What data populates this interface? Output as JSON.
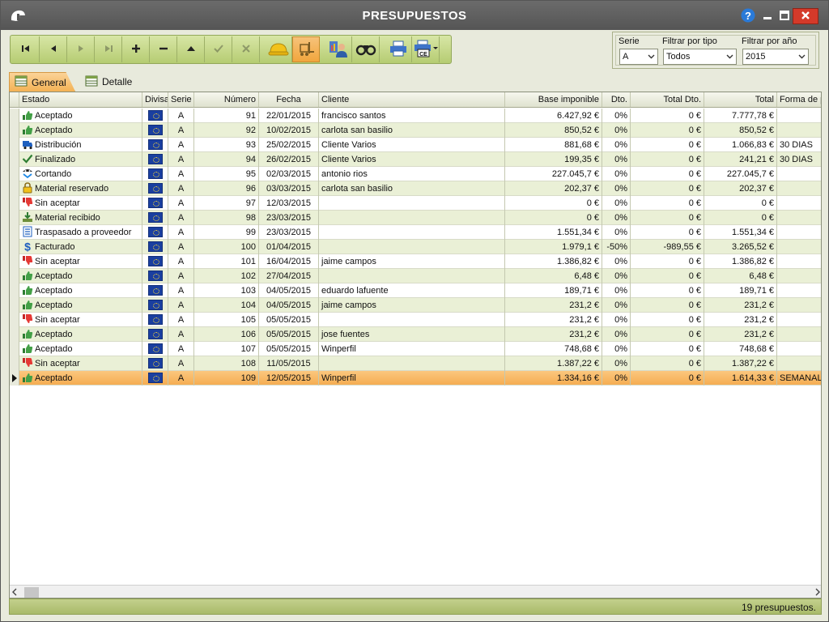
{
  "window": {
    "title": "PRESUPUESTOS",
    "help_icon": "question-mark-icon",
    "minimize_icon": "minimize-icon",
    "maximize_icon": "maximize-icon",
    "close_icon": "close-icon"
  },
  "toolbar": {
    "buttons": [
      {
        "icon": "first-record-icon",
        "enabled": true
      },
      {
        "icon": "previous-record-icon",
        "enabled": true
      },
      {
        "icon": "next-record-icon",
        "enabled": false
      },
      {
        "icon": "last-record-icon",
        "enabled": false
      },
      {
        "icon": "add-icon",
        "enabled": true
      },
      {
        "icon": "remove-icon",
        "enabled": true
      },
      {
        "icon": "move-up-icon",
        "enabled": true
      },
      {
        "icon": "confirm-check-icon",
        "enabled": false
      },
      {
        "icon": "cancel-x-icon",
        "enabled": false
      },
      {
        "icon": "hard-hat-icon",
        "enabled": true
      },
      {
        "icon": "forklift-icon",
        "enabled": true,
        "active": true
      },
      {
        "icon": "assign-user-icon",
        "enabled": true
      },
      {
        "icon": "binoculars-search-icon",
        "enabled": true
      },
      {
        "icon": "printer-icon",
        "enabled": true
      },
      {
        "icon": "printer-ce-icon",
        "enabled": true
      }
    ]
  },
  "filters": {
    "serie_label": "Serie",
    "serie_value": "A",
    "tipo_label": "Filtrar por tipo",
    "tipo_value": "Todos",
    "anio_label": "Filtrar por año",
    "anio_value": "2015"
  },
  "tabs": {
    "general": "General",
    "detalle": "Detalle"
  },
  "grid": {
    "headers": {
      "estado": "Estado",
      "divisa": "Divisa",
      "serie": "Serie",
      "numero": "Número",
      "fecha": "Fecha",
      "cliente": "Cliente",
      "base": "Base imponible",
      "dto": "Dto.",
      "total_dto": "Total Dto.",
      "total": "Total",
      "forma": "Forma de p"
    },
    "rows": [
      {
        "estado": "Aceptado",
        "icon": "thumbs-up-icon",
        "serie": "A",
        "numero": "91",
        "fecha": "22/01/2015",
        "cliente": "francisco santos",
        "base": "6.427,92 €",
        "dto": "0%",
        "total_dto": "0 €",
        "total": "7.777,78 €",
        "forma": ""
      },
      {
        "estado": "Aceptado",
        "icon": "thumbs-up-icon",
        "serie": "A",
        "numero": "92",
        "fecha": "10/02/2015",
        "cliente": "carlota san basilio",
        "base": "850,52 €",
        "dto": "0%",
        "total_dto": "0 €",
        "total": "850,52 €",
        "forma": ""
      },
      {
        "estado": "Distribución",
        "icon": "truck-icon",
        "serie": "A",
        "numero": "93",
        "fecha": "25/02/2015",
        "cliente": "Cliente Varios",
        "base": "881,68 €",
        "dto": "0%",
        "total_dto": "0 €",
        "total": "1.066,83 €",
        "forma": "30 DIAS"
      },
      {
        "estado": "Finalizado",
        "icon": "check-icon",
        "serie": "A",
        "numero": "94",
        "fecha": "26/02/2015",
        "cliente": "Cliente Varios",
        "base": "199,35 €",
        "dto": "0%",
        "total_dto": "0 €",
        "total": "241,21 €",
        "forma": "30 DIAS"
      },
      {
        "estado": "Cortando",
        "icon": "cutting-icon",
        "serie": "A",
        "numero": "95",
        "fecha": "02/03/2015",
        "cliente": "antonio rios",
        "base": "227.045,7 €",
        "dto": "0%",
        "total_dto": "0 €",
        "total": "227.045,7 €",
        "forma": ""
      },
      {
        "estado": "Material reservado",
        "icon": "lock-icon",
        "serie": "A",
        "numero": "96",
        "fecha": "03/03/2015",
        "cliente": "carlota san basilio",
        "base": "202,37 €",
        "dto": "0%",
        "total_dto": "0 €",
        "total": "202,37 €",
        "forma": ""
      },
      {
        "estado": "Sin aceptar",
        "icon": "thumbs-down-icon",
        "serie": "A",
        "numero": "97",
        "fecha": "12/03/2015",
        "cliente": "",
        "base": "0 €",
        "dto": "0%",
        "total_dto": "0 €",
        "total": "0 €",
        "forma": ""
      },
      {
        "estado": "Material recibido",
        "icon": "download-tray-icon",
        "serie": "A",
        "numero": "98",
        "fecha": "23/03/2015",
        "cliente": "",
        "base": "0 €",
        "dto": "0%",
        "total_dto": "0 €",
        "total": "0 €",
        "forma": ""
      },
      {
        "estado": "Traspasado a proveedor",
        "icon": "document-list-icon",
        "serie": "A",
        "numero": "99",
        "fecha": "23/03/2015",
        "cliente": "",
        "base": "1.551,34 €",
        "dto": "0%",
        "total_dto": "0 €",
        "total": "1.551,34 €",
        "forma": ""
      },
      {
        "estado": "Facturado",
        "icon": "dollar-icon",
        "serie": "A",
        "numero": "100",
        "fecha": "01/04/2015",
        "cliente": "",
        "base": "1.979,1 €",
        "dto": "-50%",
        "total_dto": "-989,55 €",
        "total": "3.265,52 €",
        "forma": ""
      },
      {
        "estado": "Sin aceptar",
        "icon": "thumbs-down-icon",
        "serie": "A",
        "numero": "101",
        "fecha": "16/04/2015",
        "cliente": "jaime campos",
        "base": "1.386,82 €",
        "dto": "0%",
        "total_dto": "0 €",
        "total": "1.386,82 €",
        "forma": ""
      },
      {
        "estado": "Aceptado",
        "icon": "thumbs-up-icon",
        "serie": "A",
        "numero": "102",
        "fecha": "27/04/2015",
        "cliente": "",
        "base": "6,48 €",
        "dto": "0%",
        "total_dto": "0 €",
        "total": "6,48 €",
        "forma": ""
      },
      {
        "estado": "Aceptado",
        "icon": "thumbs-up-icon",
        "serie": "A",
        "numero": "103",
        "fecha": "04/05/2015",
        "cliente": "eduardo lafuente",
        "base": "189,71 €",
        "dto": "0%",
        "total_dto": "0 €",
        "total": "189,71 €",
        "forma": ""
      },
      {
        "estado": "Aceptado",
        "icon": "thumbs-up-icon",
        "serie": "A",
        "numero": "104",
        "fecha": "04/05/2015",
        "cliente": "jaime campos",
        "base": "231,2 €",
        "dto": "0%",
        "total_dto": "0 €",
        "total": "231,2 €",
        "forma": ""
      },
      {
        "estado": "Sin aceptar",
        "icon": "thumbs-down-icon",
        "serie": "A",
        "numero": "105",
        "fecha": "05/05/2015",
        "cliente": "",
        "base": "231,2 €",
        "dto": "0%",
        "total_dto": "0 €",
        "total": "231,2 €",
        "forma": ""
      },
      {
        "estado": "Aceptado",
        "icon": "thumbs-up-icon",
        "serie": "A",
        "numero": "106",
        "fecha": "05/05/2015",
        "cliente": "jose fuentes",
        "base": "231,2 €",
        "dto": "0%",
        "total_dto": "0 €",
        "total": "231,2 €",
        "forma": ""
      },
      {
        "estado": "Aceptado",
        "icon": "thumbs-up-icon",
        "serie": "A",
        "numero": "107",
        "fecha": "05/05/2015",
        "cliente": "Winperfil",
        "base": "748,68 €",
        "dto": "0%",
        "total_dto": "0 €",
        "total": "748,68 €",
        "forma": ""
      },
      {
        "estado": "Sin aceptar",
        "icon": "thumbs-down-icon",
        "serie": "A",
        "numero": "108",
        "fecha": "11/05/2015",
        "cliente": "",
        "base": "1.387,22 €",
        "dto": "0%",
        "total_dto": "0 €",
        "total": "1.387,22 €",
        "forma": ""
      },
      {
        "estado": "Aceptado",
        "icon": "thumbs-up-icon",
        "serie": "A",
        "numero": "109",
        "fecha": "12/05/2015",
        "cliente": "Winperfil",
        "base": "1.334,16 €",
        "dto": "0%",
        "total_dto": "0 €",
        "total": "1.614,33 €",
        "forma": "SEMANALM",
        "selected": true
      }
    ]
  },
  "status": {
    "text": "19 presupuestos."
  },
  "colors": {
    "toolbar_green": "#b5cc72",
    "row_alt": "#eaf0d6",
    "selected_row": "#f5ad52",
    "close_red": "#d43a2a"
  }
}
